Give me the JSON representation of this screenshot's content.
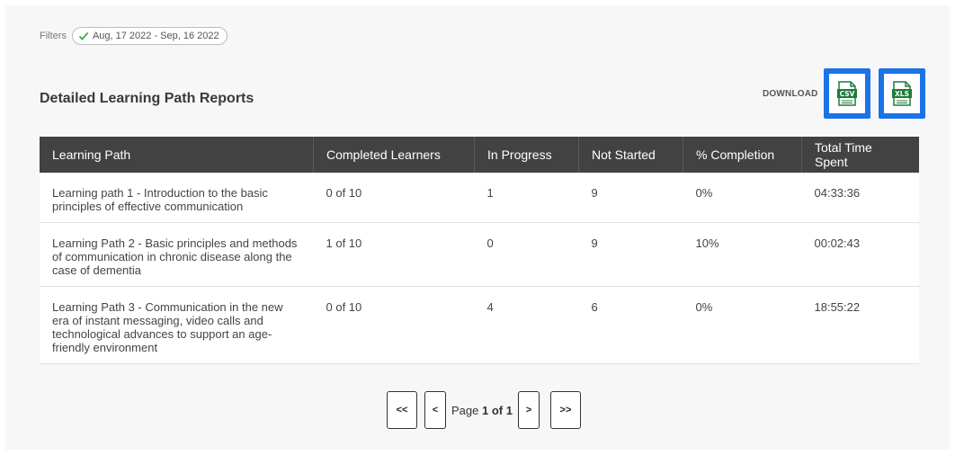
{
  "filters": {
    "label": "Filters",
    "chip": "Aug, 17 2022 - Sep, 16 2022"
  },
  "title": "Detailed Learning Path Reports",
  "download": {
    "label": "DOWNLOAD",
    "csv_label": "CSV",
    "xls_label": "XLS"
  },
  "table": {
    "headers": [
      "Learning Path",
      "Completed Learners",
      "In Progress",
      "Not Started",
      "% Completion",
      "Total Time Spent"
    ],
    "rows": [
      [
        "Learning path 1 - Introduction to the basic principles of effective communication",
        "0 of 10",
        "1",
        "9",
        "0%",
        "04:33:36"
      ],
      [
        "Learning Path 2 - Basic principles and methods of communication in chronic disease along the case of dementia",
        "1 of 10",
        "0",
        "9",
        "10%",
        "00:02:43"
      ],
      [
        "Learning Path 3 - Communication in the new era of instant messaging, video calls and technological advances to support an age-friendly environment",
        "0 of 10",
        "4",
        "6",
        "0%",
        "18:55:22"
      ]
    ]
  },
  "pager": {
    "first": "<<",
    "prev": "<",
    "page_prefix": "Page",
    "current": "1 of 1",
    "next": ">",
    "last": ">>"
  },
  "colors": {
    "accent": "#1a73e8",
    "header_bg": "#424242",
    "check": "#2e9e2e",
    "file_green": "#1e7a3c"
  }
}
